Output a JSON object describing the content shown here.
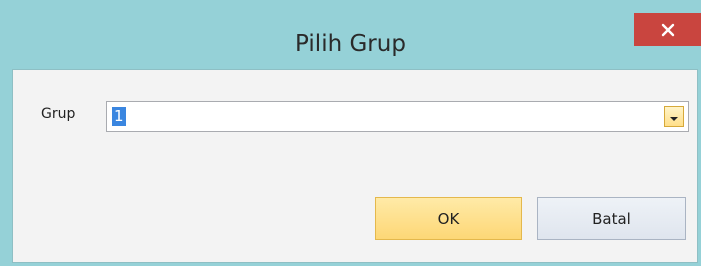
{
  "window": {
    "title": "Pilih Grup",
    "close_icon": "close-icon"
  },
  "form": {
    "group_label": "Grup",
    "group_value": "1",
    "dropdown_icon": "chevron-down-icon"
  },
  "buttons": {
    "ok_label": "OK",
    "cancel_label": "Batal"
  },
  "colors": {
    "titlebar": "#95d1d7",
    "close": "#c9453f",
    "ok": "#fdd776",
    "selection": "#3a86e0"
  }
}
